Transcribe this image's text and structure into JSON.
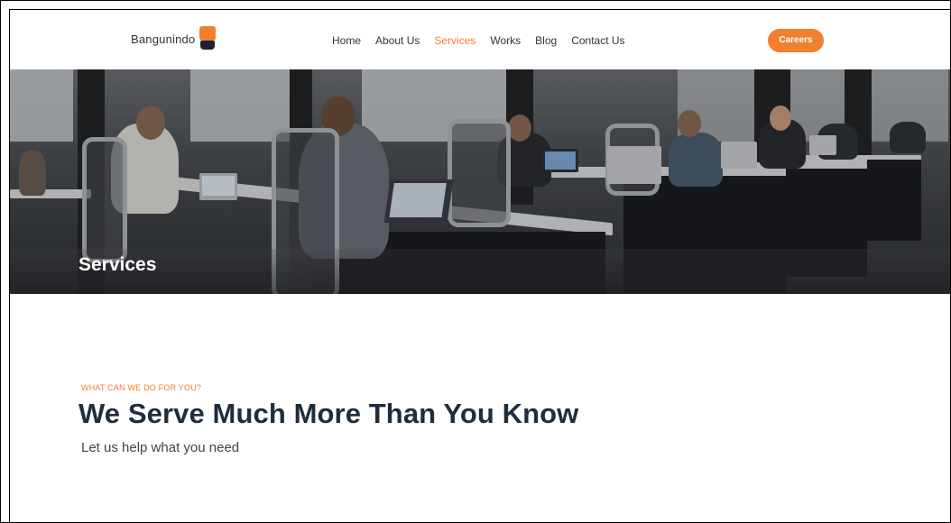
{
  "brand": {
    "name": "Bangunindo",
    "accent_color": "#f0802f",
    "dark_color": "#1f2330"
  },
  "nav": {
    "items": [
      {
        "label": "Home",
        "active": false
      },
      {
        "label": "About Us",
        "active": false
      },
      {
        "label": "Services",
        "active": true
      },
      {
        "label": "Works",
        "active": false
      },
      {
        "label": "Blog",
        "active": false
      },
      {
        "label": "Contact Us",
        "active": false
      }
    ],
    "cta_label": "Careers"
  },
  "hero": {
    "title": "Services",
    "image_description_icon": "office-photo"
  },
  "intro": {
    "eyebrow": "WHAT CAN WE DO FOR YOU?",
    "headline": "We Serve Much More Than You Know",
    "subtext": "Let us help what you need"
  }
}
